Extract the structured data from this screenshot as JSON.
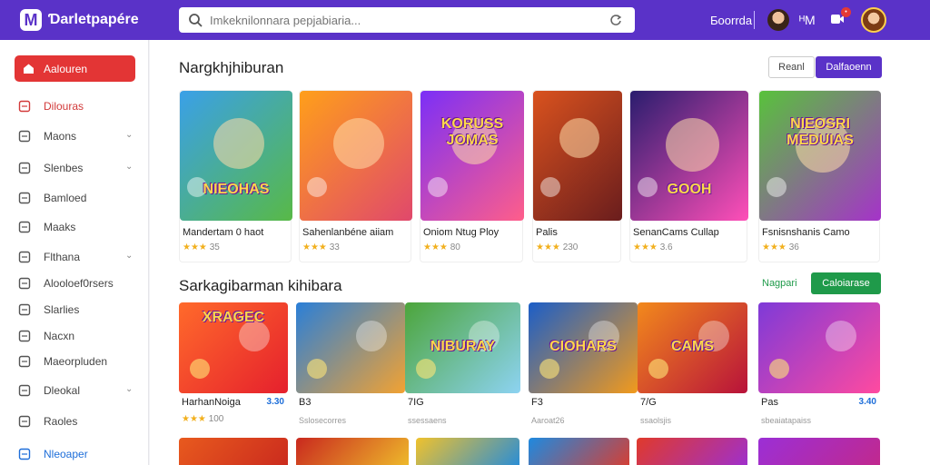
{
  "header": {
    "brand": "Ɗarletpapére",
    "search_placeholder": "Imkeknilonnara pepjabiaria...",
    "right_text": "Ƃoorrda",
    "icon_text": "ᴴM"
  },
  "sidebar": {
    "active": "Aalouren",
    "items": [
      {
        "label": "Dilouras",
        "chevron": false,
        "variant": "red",
        "icon": "gear-icon"
      },
      {
        "label": "Maons",
        "chevron": true,
        "variant": "",
        "icon": "square-icon"
      },
      {
        "label": "Slenbes",
        "chevron": true,
        "variant": "",
        "icon": "list-icon"
      },
      {
        "label": "Bamloed",
        "chevron": false,
        "variant": "",
        "icon": "calendar-icon"
      },
      {
        "label": "Maaks",
        "chevron": false,
        "variant": "",
        "icon": "document-icon"
      },
      {
        "label": "Flthana",
        "chevron": true,
        "variant": "",
        "icon": "grid-icon"
      },
      {
        "label": "Alooloef0rsers",
        "chevron": false,
        "variant": "",
        "icon": "folder-icon"
      },
      {
        "label": "Slarlies",
        "chevron": false,
        "variant": "",
        "icon": "box-icon"
      },
      {
        "label": "Nacxn",
        "chevron": false,
        "variant": "",
        "icon": "tag-icon"
      },
      {
        "label": "Maeorpluden",
        "chevron": false,
        "variant": "",
        "icon": "page-icon"
      },
      {
        "label": "Dleokal",
        "chevron": true,
        "variant": "",
        "icon": "pen-icon"
      },
      {
        "label": "Raoles",
        "chevron": false,
        "variant": "",
        "icon": "search-icon"
      },
      {
        "label": "Nleoaper",
        "chevron": false,
        "variant": "blue",
        "icon": "monitor-icon"
      }
    ]
  },
  "section1": {
    "title": "Nargkhjhiburan",
    "btn_outline": "Reanl",
    "btn_primary": "Dalfaoenn",
    "cards": [
      {
        "title": "Mandertam 0 haot",
        "rating": "35",
        "art": "NIEOHAS",
        "c1": "#3aa0e8",
        "c2": "#58b947"
      },
      {
        "title": "Sahenlanbéne aiiam",
        "rating": "33",
        "art": "",
        "c1": "#ff9f1a",
        "c2": "#e0486c"
      },
      {
        "title": "Oniom Ntug Ploy",
        "rating": "80",
        "art": "KORUSS JOMAS",
        "c1": "#7b2ff7",
        "c2": "#ff5e8a"
      },
      {
        "title": "Palis",
        "rating": "230",
        "art": "",
        "c1": "#d9521e",
        "c2": "#6a1d1d"
      },
      {
        "title": "SenanCams Cullap",
        "rating": "3.6",
        "art": "GOOH",
        "c1": "#2a1d6e",
        "c2": "#ff4fb8"
      },
      {
        "title": "Fsnisnshanis Camo",
        "rating": "36",
        "art": "NIEOSRI MEDUIAS",
        "c1": "#58c23b",
        "c2": "#a533c9"
      }
    ]
  },
  "section2": {
    "title": "Sarkagibarman kihibara",
    "link": "Nagpari",
    "button": "Caloiarase",
    "cards": [
      {
        "title": "HarhanNoiga",
        "price": "3.30",
        "sub": "",
        "rating": "100",
        "art": "XRAGEC",
        "c1": "#ff6a2b",
        "c2": "#e5202d"
      },
      {
        "title": "B3",
        "price": "",
        "sub": "Sslosecorres",
        "rating": "",
        "art": "",
        "c1": "#2a7fd8",
        "c2": "#f2a232"
      },
      {
        "title": "7IG",
        "price": "",
        "sub": "ssessaens",
        "rating": "",
        "art": "NIBURAY",
        "c1": "#4ca53a",
        "c2": "#8dd3f2"
      },
      {
        "title": "F3",
        "price": "",
        "sub": "Aaroat26",
        "rating": "",
        "art": "CIOHARS",
        "c1": "#1b5ec8",
        "c2": "#f29a1c"
      },
      {
        "title": "7/G",
        "price": "",
        "sub": "ssaolsjis",
        "rating": "",
        "art": "CAMS",
        "c1": "#f2891c",
        "c2": "#b8123a"
      },
      {
        "title": "Pas",
        "price": "3.40",
        "sub": "sbeaiatapaiss",
        "rating": "",
        "art": "",
        "c1": "#7e3ad8",
        "c2": "#ff4aa0"
      }
    ],
    "peek_colors": [
      "#e85a1e",
      "#c9281e",
      "#f0c22c",
      "#1e8ae0",
      "#e03a2a",
      "#9b2fd6",
      "#c3288a"
    ]
  }
}
